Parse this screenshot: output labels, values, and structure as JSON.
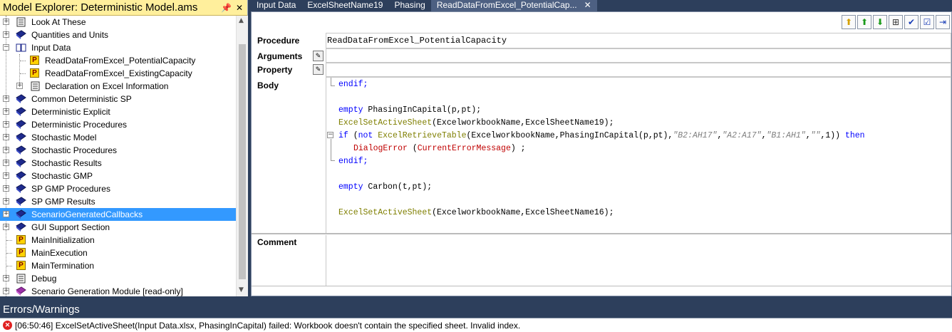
{
  "explorer": {
    "title": "Model Explorer: Deterministic Model.ams",
    "pin_icon": "pin-icon",
    "close_icon": "close-icon",
    "items": [
      {
        "label": "Look At These",
        "icon": "script-icon",
        "expander": "+"
      },
      {
        "label": "Quantities and Units",
        "icon": "book-icon",
        "expander": "+"
      },
      {
        "label": "Input Data",
        "icon": "book-open-icon",
        "expander": "-"
      },
      {
        "label": "ReadDataFromExcel_PotentialCapacity",
        "icon": "procedure-icon"
      },
      {
        "label": "ReadDataFromExcel_ExistingCapacity",
        "icon": "procedure-icon"
      },
      {
        "label": "Declaration on Excel Information",
        "icon": "script-icon",
        "expander": "+"
      },
      {
        "label": "Common Deterministic SP",
        "icon": "book-icon",
        "expander": "+"
      },
      {
        "label": "Deterministic Explicit",
        "icon": "book-icon",
        "expander": "+"
      },
      {
        "label": "Deterministic Procedures",
        "icon": "book-icon",
        "expander": "+"
      },
      {
        "label": "Stochastic Model",
        "icon": "book-icon",
        "expander": "+"
      },
      {
        "label": "Stochastic  Procedures",
        "icon": "book-icon",
        "expander": "+"
      },
      {
        "label": "Stochastic Results",
        "icon": "book-icon",
        "expander": "+"
      },
      {
        "label": "Stochastic GMP",
        "icon": "book-icon",
        "expander": "+"
      },
      {
        "label": "SP GMP Procedures",
        "icon": "book-icon",
        "expander": "+"
      },
      {
        "label": "SP GMP Results",
        "icon": "book-icon",
        "expander": "+"
      },
      {
        "label": "ScenarioGeneratedCallbacks",
        "icon": "book-icon",
        "expander": "+"
      },
      {
        "label": "GUI Support Section",
        "icon": "book-icon",
        "expander": "+"
      },
      {
        "label": "MainInitialization",
        "icon": "procedure-icon"
      },
      {
        "label": "MainExecution",
        "icon": "procedure-icon"
      },
      {
        "label": "MainTermination",
        "icon": "procedure-icon"
      },
      {
        "label": "Debug",
        "icon": "script-icon",
        "expander": "+"
      },
      {
        "label": "Scenario Generation Module [read-only]",
        "icon": "module-icon",
        "expander": "+"
      }
    ]
  },
  "tabs": [
    {
      "label": "Input Data"
    },
    {
      "label": "ExcelSheetName19"
    },
    {
      "label": "Phasing"
    },
    {
      "label": "ReadDataFromExcel_PotentialCap...",
      "close": "✕"
    }
  ],
  "toolbar": {
    "buttons": [
      "arrow-up-yellow-icon",
      "arrow-up-green-icon",
      "arrow-down-green-icon",
      "tree-icon",
      "check-icon",
      "check-list-icon",
      "export-icon"
    ]
  },
  "fields": {
    "procedure_label": "Procedure",
    "procedure_value": "ReadDataFromExcel_PotentialCapacity",
    "arguments_label": "Arguments",
    "property_label": "Property",
    "body_label": "Body",
    "comment_label": "Comment",
    "dots_button": "..."
  },
  "code": {
    "l1": "endif;",
    "l3_kw": "empty",
    "l3_rest": " PhasingInCapital(p,pt);",
    "l4_fn": "ExcelSetActiveSheet",
    "l4_rest": "(ExcelworkbookName,ExcelSheetName19);",
    "l5_if": "if",
    "l5_a": " (",
    "l5_not": "not",
    "l5_sp": " ",
    "l5_fn": "ExcelRetrieveTable",
    "l5_args": "(ExcelworkbookName,PhasingInCapital(p,pt),",
    "l5_s1": "\"B2:AH17\"",
    "l5_c1": ",",
    "l5_s2": "\"A2:A17\"",
    "l5_c2": ",",
    "l5_s3": "\"B1:AH1\"",
    "l5_c3": ",",
    "l5_s4": "\"\"",
    "l5_end": ",1))",
    "l5_then": " then",
    "l6_fn": "DialogError",
    "l6_a": " (",
    "l6_arg": "CurrentErrorMessage",
    "l6_end": ") ;",
    "l7": "endif;",
    "l9_kw": "empty",
    "l9_rest": " Carbon(t,pt);",
    "l11_fn": "ExcelSetActiveSheet",
    "l11_rest": "(ExcelworkbookName,ExcelSheetName16);"
  },
  "errors": {
    "title": "Errors/Warnings",
    "items": [
      {
        "icon": "✕",
        "text": "[06:50:46]  ExcelSetActiveSheet(Input Data.xlsx, PhasingInCapital) failed: Workbook doesn't contain the specified sheet. Invalid index."
      }
    ]
  }
}
